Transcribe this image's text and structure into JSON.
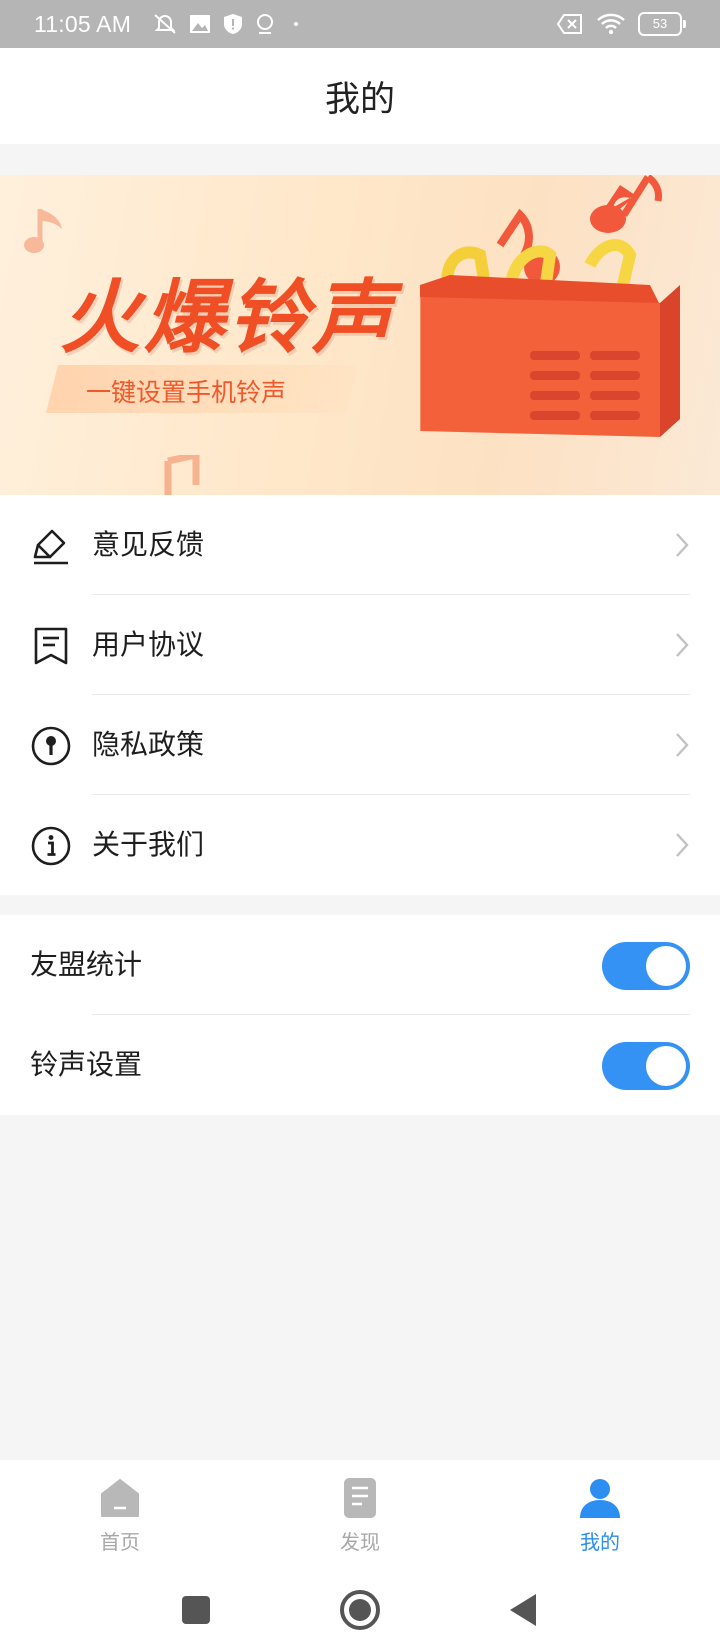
{
  "status_bar": {
    "time": "11:05 AM",
    "battery": "53"
  },
  "header": {
    "title": "我的"
  },
  "banner": {
    "title": "火爆铃声",
    "subtitle": "一键设置手机铃声"
  },
  "menu": [
    {
      "label": "意见反馈",
      "icon": "feedback-pen-icon"
    },
    {
      "label": "用户协议",
      "icon": "document-icon"
    },
    {
      "label": "隐私政策",
      "icon": "privacy-lock-icon"
    },
    {
      "label": "关于我们",
      "icon": "info-icon"
    }
  ],
  "toggles": [
    {
      "label": "友盟统计",
      "state": "on"
    },
    {
      "label": "铃声设置",
      "state": "on"
    }
  ],
  "bottom_nav": [
    {
      "label": "首页",
      "icon": "home-icon",
      "active": false
    },
    {
      "label": "发现",
      "icon": "discover-icon",
      "active": false
    },
    {
      "label": "我的",
      "icon": "profile-icon",
      "active": true
    }
  ],
  "colors": {
    "accent": "#3592f5",
    "banner_text": "#f04e25",
    "inactive": "#a8a8a8"
  }
}
